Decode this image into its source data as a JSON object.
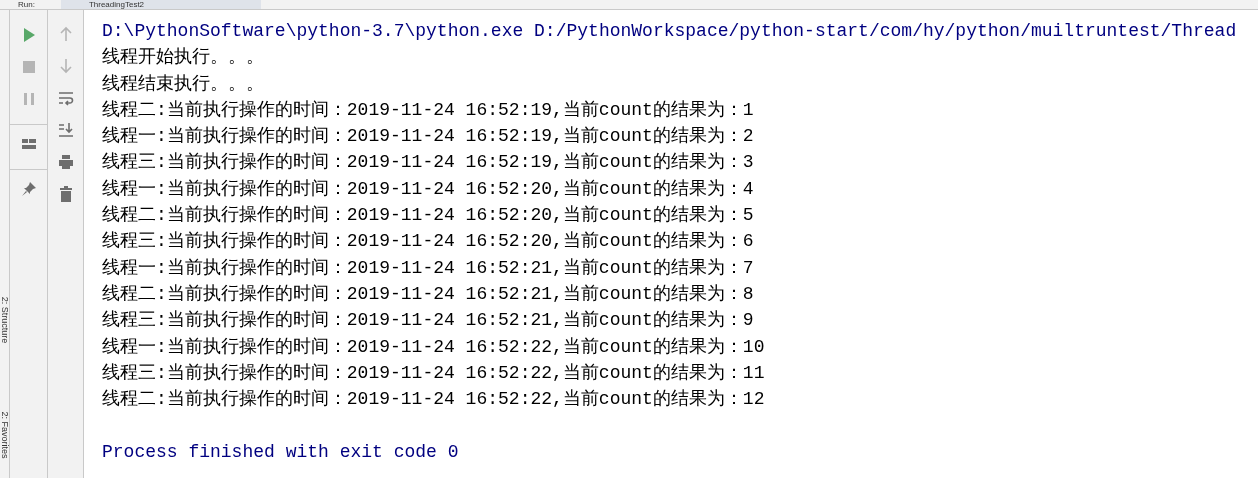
{
  "header": {
    "label": "Run:",
    "tab": "ThreadingTest2"
  },
  "side_tabs": [
    "2: Structure",
    "2: Favorites"
  ],
  "toolbar_left": [
    {
      "kind": "run",
      "disabled": false
    },
    {
      "kind": "stop",
      "disabled": true
    },
    {
      "kind": "pause",
      "disabled": true
    },
    {
      "kind": "layout",
      "disabled": false
    },
    {
      "kind": "pin",
      "disabled": false
    }
  ],
  "toolbar_right": [
    {
      "kind": "up",
      "disabled": true
    },
    {
      "kind": "down",
      "disabled": true
    },
    {
      "kind": "wrap",
      "disabled": false
    },
    {
      "kind": "scroll-end",
      "disabled": false
    },
    {
      "kind": "print",
      "disabled": false
    },
    {
      "kind": "trash",
      "disabled": false
    }
  ],
  "console": [
    {
      "kind": "command",
      "text": "D:\\PythonSoftware\\python-3.7\\python.exe D:/PythonWorkspace/python-start/com/hy/python/muiltruntest/Thread"
    },
    {
      "kind": "output",
      "text": "线程开始执行。。。"
    },
    {
      "kind": "output",
      "text": "线程结束执行。。。"
    },
    {
      "kind": "output",
      "text": "线程二:当前执行操作的时间：2019-11-24 16:52:19,当前count的结果为：1"
    },
    {
      "kind": "output",
      "text": "线程一:当前执行操作的时间：2019-11-24 16:52:19,当前count的结果为：2"
    },
    {
      "kind": "output",
      "text": "线程三:当前执行操作的时间：2019-11-24 16:52:19,当前count的结果为：3"
    },
    {
      "kind": "output",
      "text": "线程一:当前执行操作的时间：2019-11-24 16:52:20,当前count的结果为：4"
    },
    {
      "kind": "output",
      "text": "线程二:当前执行操作的时间：2019-11-24 16:52:20,当前count的结果为：5"
    },
    {
      "kind": "output",
      "text": "线程三:当前执行操作的时间：2019-11-24 16:52:20,当前count的结果为：6"
    },
    {
      "kind": "output",
      "text": "线程一:当前执行操作的时间：2019-11-24 16:52:21,当前count的结果为：7"
    },
    {
      "kind": "output",
      "text": "线程二:当前执行操作的时间：2019-11-24 16:52:21,当前count的结果为：8"
    },
    {
      "kind": "output",
      "text": "线程三:当前执行操作的时间：2019-11-24 16:52:21,当前count的结果为：9"
    },
    {
      "kind": "output",
      "text": "线程一:当前执行操作的时间：2019-11-24 16:52:22,当前count的结果为：10"
    },
    {
      "kind": "output",
      "text": "线程三:当前执行操作的时间：2019-11-24 16:52:22,当前count的结果为：11"
    },
    {
      "kind": "output",
      "text": "线程二:当前执行操作的时间：2019-11-24 16:52:22,当前count的结果为：12"
    },
    {
      "kind": "blank"
    },
    {
      "kind": "exit",
      "text": "Process finished with exit code 0"
    }
  ]
}
